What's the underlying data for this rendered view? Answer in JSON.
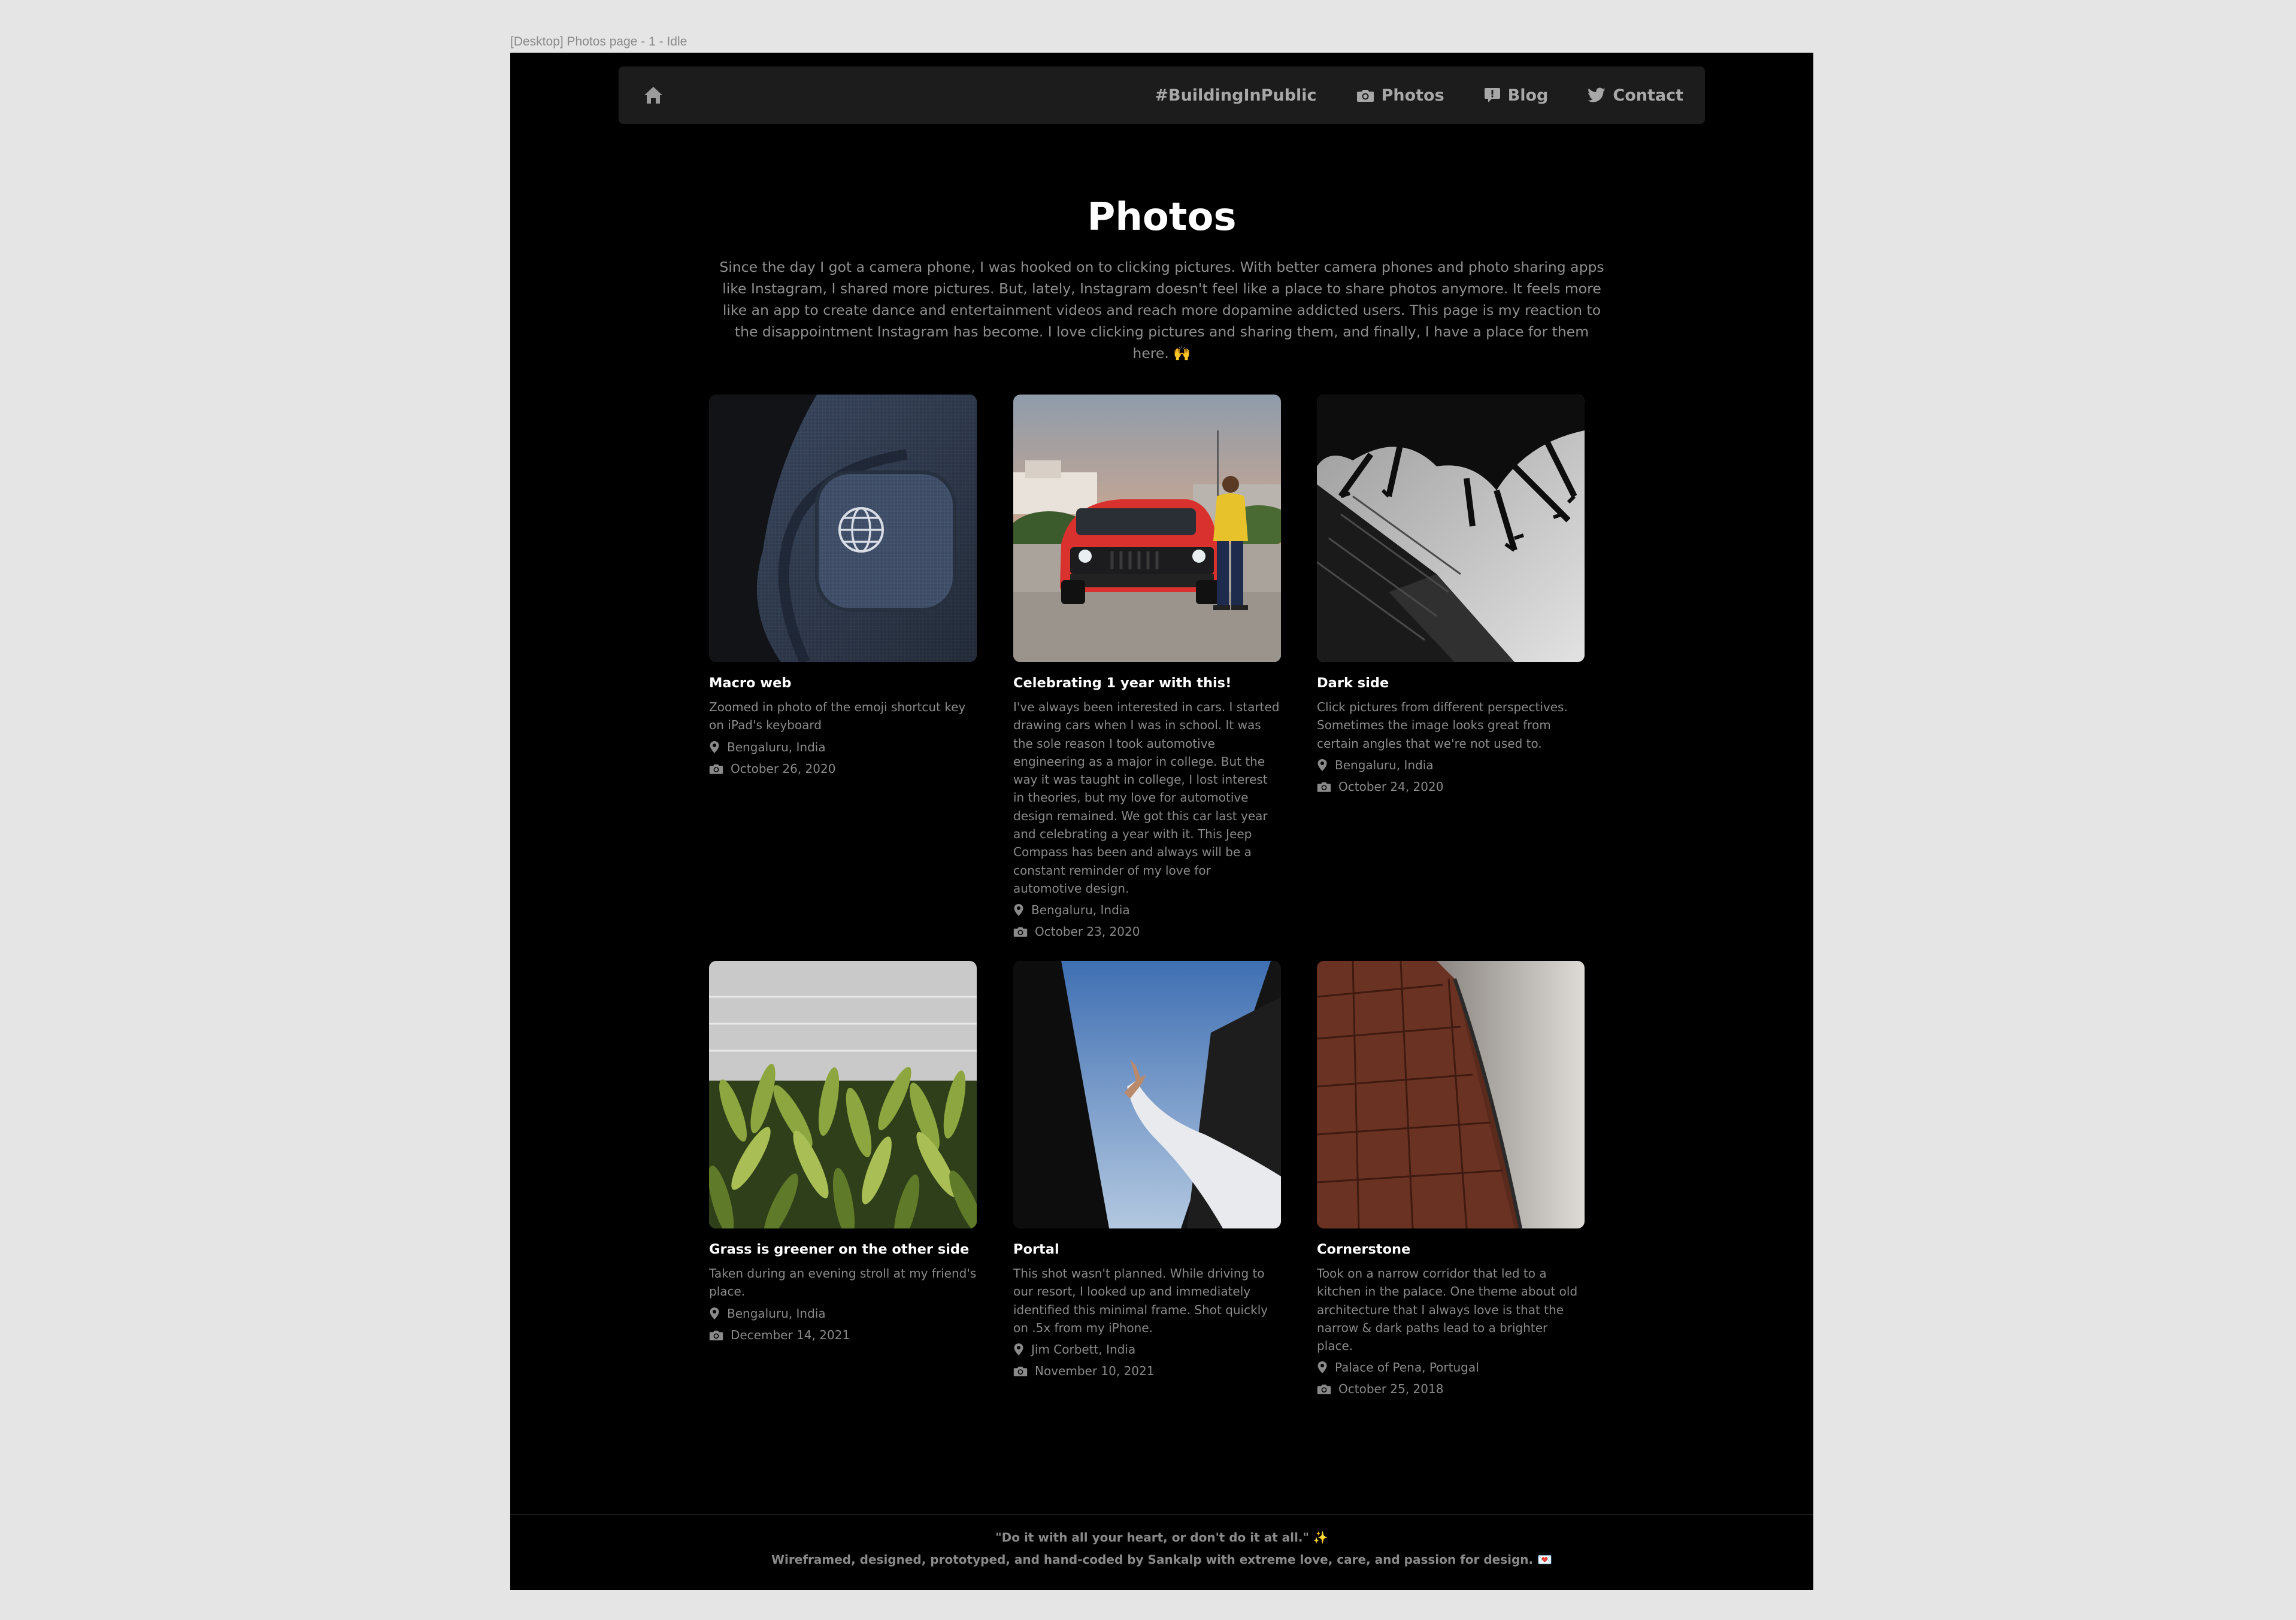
{
  "frame": {
    "label": "[Desktop] Photos page - 1 - Idle"
  },
  "nav": {
    "home_icon": "home-icon",
    "links": [
      {
        "label": "#BuildingInPublic",
        "icon": ""
      },
      {
        "label": "Photos",
        "icon": "camera-icon"
      },
      {
        "label": "Blog",
        "icon": "chat-bubble-icon"
      },
      {
        "label": "Contact",
        "icon": "twitter-icon"
      }
    ]
  },
  "page": {
    "title": "Photos",
    "intro": "Since the day I got a camera phone, I was hooked on to clicking pictures. With better camera phones and photo sharing apps like Instagram, I shared more pictures. But, lately, Instagram doesn't feel like a place to share photos anymore. It feels more like an app to create dance and entertainment videos and reach more dopamine addicted users. This page is my reaction to the disappointment Instagram has become. I love clicking pictures and sharing them, and finally, I have a place for them here. 🙌"
  },
  "photos": [
    {
      "title": "Macro web",
      "description": "Zoomed in photo of the emoji shortcut key on iPad's keyboard",
      "location": "Bengaluru, India",
      "date": "October 26, 2020"
    },
    {
      "title": "Celebrating 1 year with this!",
      "description": "I've always been interested in cars. I started drawing cars when I was in school. It was the sole reason I took automotive engineering as a major in college. But the way it was taught in college, I lost interest in theories, but my love for automotive design remained. We got this car last year and celebrating a year with it. This Jeep Compass has been and always will be a constant reminder of my love for automotive design.",
      "location": "Bengaluru, India",
      "date": "October 23, 2020"
    },
    {
      "title": "Dark side",
      "description": "Click pictures from different perspectives. Sometimes the image looks great from certain angles that we're not used to.",
      "location": "Bengaluru, India",
      "date": "October 24, 2020"
    },
    {
      "title": "Grass is greener on the other side",
      "description": "Taken during an evening stroll at my friend's place.",
      "location": "Bengaluru, India",
      "date": "December 14, 2021"
    },
    {
      "title": "Portal",
      "description": "This shot wasn't planned. While driving to our resort, I looked up and immediately identified this minimal frame. Shot quickly on .5x from my iPhone.",
      "location": "Jim Corbett, India",
      "date": "November 10, 2021"
    },
    {
      "title": "Cornerstone",
      "description": "Took on a narrow corridor that led to a kitchen in the palace. One theme about old architecture that I always love is that the narrow & dark paths lead to a brighter place.",
      "location": "Palace of Pena, Portugal",
      "date": "October 25, 2018"
    }
  ],
  "footer": {
    "quote": "\"Do it with all your heart, or don't do it at all.\" ✨",
    "credit": "Wireframed, designed, prototyped, and hand-coded by Sankalp with extreme love, care, and passion for design. 💌"
  },
  "colors": {
    "background": "#000000",
    "nav": "#1c1c1c",
    "muted_text": "#8a8a8a",
    "canvas": "#e5e5e5"
  }
}
